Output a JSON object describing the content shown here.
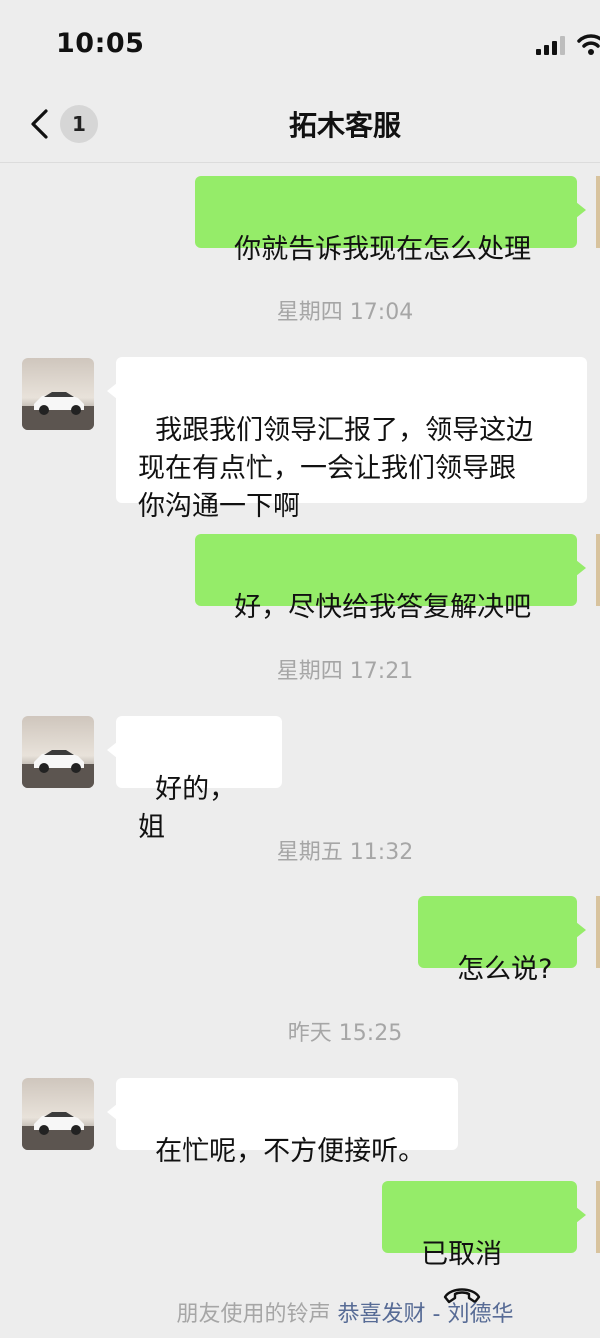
{
  "status_bar": {
    "time": "10:05"
  },
  "header": {
    "back_badge": "1",
    "title": "拓木客服"
  },
  "messages": [
    {
      "type": "out",
      "text": "你就告诉我现在怎么处理"
    },
    {
      "type": "time",
      "text": "星期四 17:04"
    },
    {
      "type": "in",
      "text": "我跟我们领导汇报了，领导这边\n现在有点忙，一会让我们领导跟\n你沟通一下啊"
    },
    {
      "type": "out",
      "text": "好，尽快给我答复解决吧"
    },
    {
      "type": "time",
      "text": "星期四 17:21"
    },
    {
      "type": "in",
      "text": "好的，姐"
    },
    {
      "type": "time",
      "text": "星期五 11:32"
    },
    {
      "type": "out",
      "text": "怎么说?"
    },
    {
      "type": "time",
      "text": "昨天 15:25"
    },
    {
      "type": "in",
      "text": "在忙呢，不方便接听。"
    },
    {
      "type": "out-call",
      "text": "已取消"
    }
  ],
  "ringtone": {
    "prefix": "朋友使用的铃声",
    "song": "恭喜发财 - 刘德华"
  },
  "colors": {
    "background": "#ededed",
    "outgoing_bubble": "#95ec69",
    "incoming_bubble": "#ffffff",
    "timestamp_text": "#a6a6a6",
    "link_text": "#576b95"
  }
}
